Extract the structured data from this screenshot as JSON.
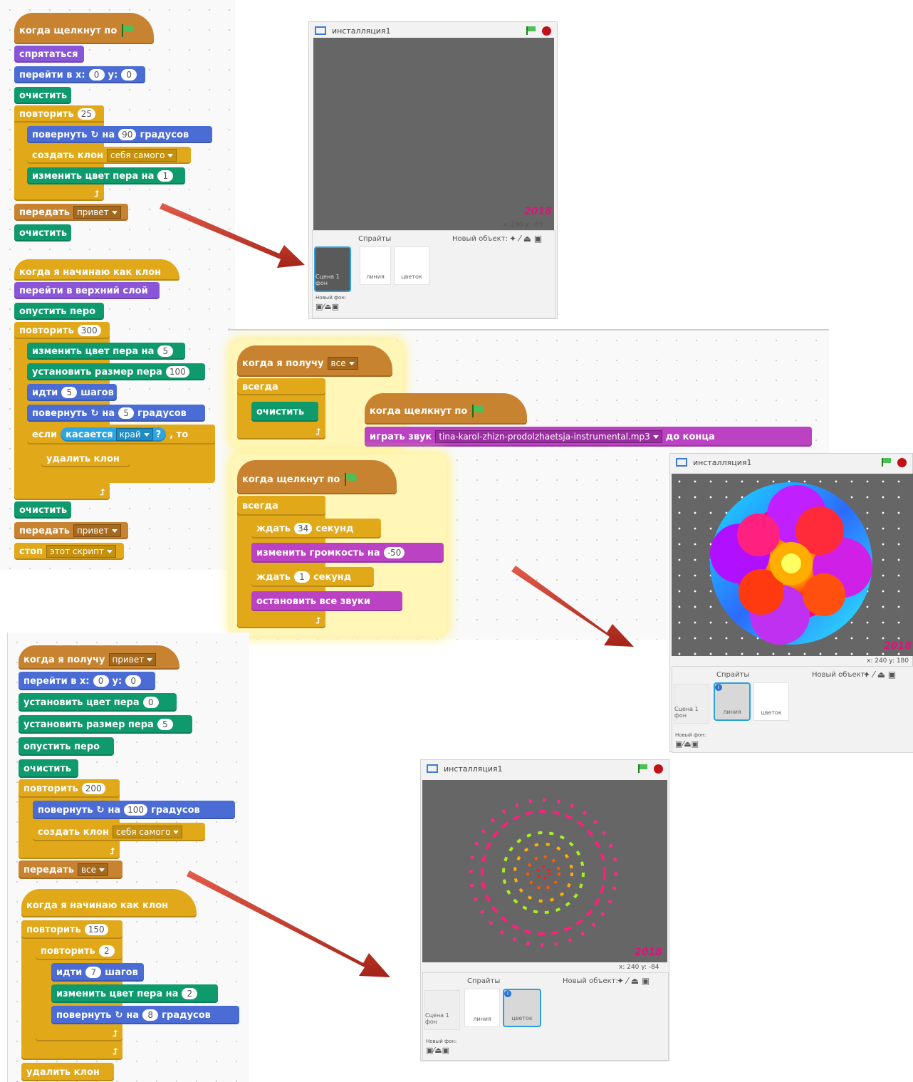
{
  "script_area_1": {
    "s1": {
      "hat": "когда щелкнут по",
      "hide": "спрятаться",
      "goto": {
        "label": "перейти в x:",
        "x": "0",
        "ylabel": "y:",
        "y": "0"
      },
      "clear1": "очистить",
      "repeat": {
        "label": "повторить",
        "n": "25"
      },
      "turn": {
        "label": "повернуть",
        "on": "на",
        "n": "90",
        "unit": "градусов"
      },
      "clone": {
        "label": "создать клон",
        "target": "себя самого"
      },
      "color": {
        "label": "изменить цвет пера на",
        "n": "1"
      },
      "broadcast": {
        "label": "передать",
        "msg": "привет"
      },
      "clear2": "очистить"
    },
    "s2": {
      "hat": "когда я начинаю как клон",
      "front": "перейти в верхний слой",
      "pendown": "опустить перо",
      "repeat": {
        "label": "повторить",
        "n": "300"
      },
      "color": {
        "label": "изменить цвет пера на",
        "n": "5"
      },
      "size": {
        "label": "установить размер пера",
        "n": "100"
      },
      "move": {
        "label": "идти",
        "n": "5",
        "unit": "шагов"
      },
      "turn": {
        "label": "повернуть",
        "on": "на",
        "n": "5",
        "unit": "градусов"
      },
      "if": {
        "label": "если",
        "cond": "касается",
        "target": "край",
        "q": "?",
        "then": ", то"
      },
      "delete": "удалить клон",
      "clear": "очистить",
      "broadcast": {
        "label": "передать",
        "msg": "привет"
      },
      "stop": {
        "label": "стоп",
        "opt": "этот скрипт"
      }
    }
  },
  "stage_top": {
    "title": "инсталляция1",
    "stamp": "2018",
    "coords": "x: 240  y: -89",
    "sprites_label": "Спрайты",
    "new_object": "Новый объект:",
    "stage_thumb": "Сцена 1 фон",
    "new_backdrop": "Новый фон:",
    "sprites": [
      "линия",
      "цветок"
    ]
  },
  "script_area_2": {
    "a": {
      "hat": "когда я получу",
      "msg": "все",
      "forever": "всегда",
      "clear": "очистить"
    },
    "b": {
      "hat": "когда щелкнут по",
      "play": "играть звук",
      "sound": "tina-karol-zhizn-prodolzhaetsja-instrumental.mp3",
      "until": "до конца"
    },
    "c": {
      "hat": "когда щелкнут по",
      "forever": "всегда",
      "wait1": {
        "label": "ждать",
        "n": "34",
        "unit": "секунд"
      },
      "volume": {
        "label": "изменить громкость на",
        "n": "-50"
      },
      "wait2": {
        "label": "ждать",
        "n": "1",
        "unit": "секунд"
      },
      "stopall": "остановить все звуки"
    }
  },
  "stage_mid": {
    "title": "инсталляция1",
    "stamp": "2018",
    "coords": "x: 240  y: 180",
    "sprites_label": "Спрайты",
    "new_object": "Новый объект:",
    "stage_thumb": "Сцена 1 фон",
    "new_backdrop": "Новый фон:",
    "sprites": [
      "линия",
      "цветок"
    ]
  },
  "script_area_3": {
    "s1": {
      "hat": "когда я получу",
      "msg": "привет",
      "goto": {
        "label": "перейти в x:",
        "x": "0",
        "ylabel": "y:",
        "y": "0"
      },
      "setcolor": {
        "label": "установить цвет пера",
        "n": "0"
      },
      "setsize": {
        "label": "установить размер пера",
        "n": "5"
      },
      "pendown": "опустить перо",
      "clear": "очистить",
      "repeat": {
        "label": "повторить",
        "n": "200"
      },
      "turn": {
        "label": "повернуть",
        "on": "на",
        "n": "100",
        "unit": "градусов"
      },
      "clone": {
        "label": "создать клон",
        "target": "себя самого"
      },
      "broadcast": {
        "label": "передать",
        "msg": "все"
      }
    },
    "s2": {
      "hat": "когда я начинаю как клон",
      "repeat1": {
        "label": "повторить",
        "n": "150"
      },
      "repeat2": {
        "label": "повторить",
        "n": "2"
      },
      "move": {
        "label": "идти",
        "n": "7",
        "unit": "шагов"
      },
      "color": {
        "label": "изменить цвет пера на",
        "n": "2"
      },
      "turn": {
        "label": "повернуть",
        "on": "на",
        "n": "8",
        "unit": "градусов"
      },
      "delete": "удалить клон"
    }
  },
  "stage_bottom": {
    "title": "инсталляция1",
    "stamp": "2018",
    "coords": "x: 240  y: -84",
    "sprites_label": "Спрайты",
    "new_object": "Новый объект:",
    "stage_thumb": "Сцена 1 фон",
    "new_backdrop": "Новый фон:",
    "sprites": [
      "линия",
      "цветок"
    ]
  },
  "icons": [
    "green-flag-icon",
    "stop-icon",
    "fullscreen-icon",
    "turn-right-icon",
    "loop-arrow-icon",
    "paint-icon",
    "brush-icon",
    "upload-icon",
    "camera-icon",
    "info-icon"
  ],
  "colors": {
    "events": "#c88330",
    "control": "#e1a91a",
    "looks": "#8a55d7",
    "motion": "#4a6cd4",
    "pen": "#0e9a6c",
    "sound": "#bb42c3",
    "sensing": "#2ca5e2",
    "stage_bg": "#666666",
    "arrow": "#c0392b"
  }
}
